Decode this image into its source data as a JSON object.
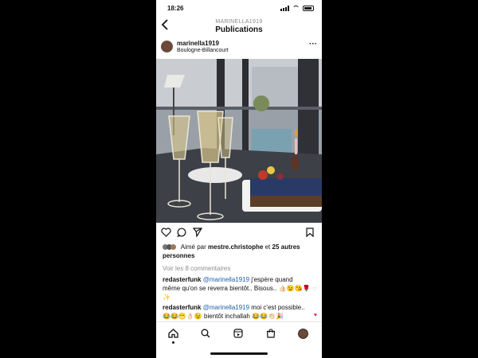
{
  "status_bar": {
    "time": "18:26"
  },
  "nav": {
    "username": "MARINELLA1919",
    "title": "Publications"
  },
  "post": {
    "username": "marinella1919",
    "location": "Boulogne-Billancourt",
    "liked_by_prefix": "Aimé par ",
    "liked_by_user": "mestre.christophe",
    "liked_by_suffix": " et ",
    "others": "25 autres personnes",
    "view_comments": "Voir les 8 commentaires"
  },
  "comments": [
    {
      "author": "redasterfunk",
      "mention": "@marinella1919",
      "text": " j'espère quand même qu'on se reverra bientôt.. Bisous.. 👍🏻😉😘🌹✨"
    },
    {
      "author": "redasterfunk",
      "mention": "@marinella1919",
      "text": " moi c'est possible.. 😂😂😁👌🏻😉 bientôt inchallah 😂😂👏🏻🎉"
    }
  ],
  "icons": {
    "back": "chevron-left-icon",
    "more": "more-dots-icon",
    "like": "heart-icon",
    "comment": "comment-icon",
    "share": "send-icon",
    "save": "bookmark-icon",
    "home": "home-icon",
    "search": "search-icon",
    "reels": "reels-icon",
    "shop": "shop-icon",
    "profile": "profile-avatar-icon"
  },
  "colors": {
    "mention": "#1f5fa8",
    "secondary_text": "#8e8e8e",
    "liked_heart": "#e0245e"
  }
}
